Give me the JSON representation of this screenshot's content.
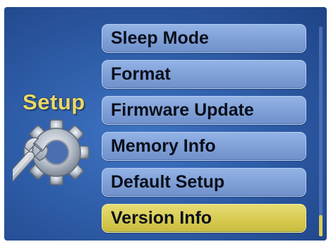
{
  "title": "Setup",
  "menu": {
    "items": [
      {
        "label": "Sleep Mode",
        "selected": false
      },
      {
        "label": "Format",
        "selected": false
      },
      {
        "label": "Firmware Update",
        "selected": false
      },
      {
        "label": "Memory Info",
        "selected": false
      },
      {
        "label": "Default Setup",
        "selected": false
      },
      {
        "label": "Version Info",
        "selected": true
      }
    ]
  },
  "scrollbar": {
    "position": 1.0
  },
  "icon": "gear-wrench-icon",
  "colors": {
    "background": "#2f5ea9",
    "item": "#7e9fd6",
    "selected_item": "#d5c94e",
    "title": "#e9d867"
  }
}
